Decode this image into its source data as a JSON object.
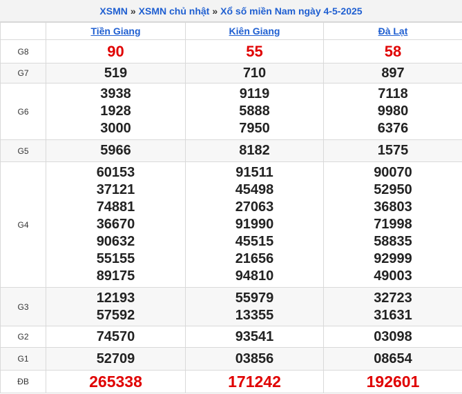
{
  "breadcrumb": {
    "link1": "XSMN",
    "sep1": "»",
    "link2": "XSMN chủ nhật",
    "sep2": "»",
    "title": "Xổ số miền Nam ngày 4-5-2025"
  },
  "provinces": [
    "Tiền Giang",
    "Kiên Giang",
    "Đà Lạt"
  ],
  "prizes": [
    {
      "label": "G8",
      "results": [
        [
          "90"
        ],
        [
          "55"
        ],
        [
          "58"
        ]
      ]
    },
    {
      "label": "G7",
      "results": [
        [
          "519"
        ],
        [
          "710"
        ],
        [
          "897"
        ]
      ]
    },
    {
      "label": "G6",
      "results": [
        [
          "3938",
          "1928",
          "3000"
        ],
        [
          "9119",
          "5888",
          "7950"
        ],
        [
          "7118",
          "9980",
          "6376"
        ]
      ]
    },
    {
      "label": "G5",
      "results": [
        [
          "5966"
        ],
        [
          "8182"
        ],
        [
          "1575"
        ]
      ]
    },
    {
      "label": "G4",
      "results": [
        [
          "60153",
          "37121",
          "74881",
          "36670",
          "90632",
          "55155",
          "89175"
        ],
        [
          "91511",
          "45498",
          "27063",
          "91990",
          "45515",
          "21656",
          "94810"
        ],
        [
          "90070",
          "52950",
          "36803",
          "71998",
          "58835",
          "92999",
          "49003"
        ]
      ]
    },
    {
      "label": "G3",
      "results": [
        [
          "12193",
          "57592"
        ],
        [
          "55979",
          "13355"
        ],
        [
          "32723",
          "31631"
        ]
      ]
    },
    {
      "label": "G2",
      "results": [
        [
          "74570"
        ],
        [
          "93541"
        ],
        [
          "03098"
        ]
      ]
    },
    {
      "label": "G1",
      "results": [
        [
          "52709"
        ],
        [
          "03856"
        ],
        [
          "08654"
        ]
      ]
    },
    {
      "label": "ĐB",
      "results": [
        [
          "265338"
        ],
        [
          "171242"
        ],
        [
          "192601"
        ]
      ]
    }
  ],
  "colors": {
    "link": "#1f5fd1",
    "special": "#e00000",
    "text": "#222222"
  }
}
